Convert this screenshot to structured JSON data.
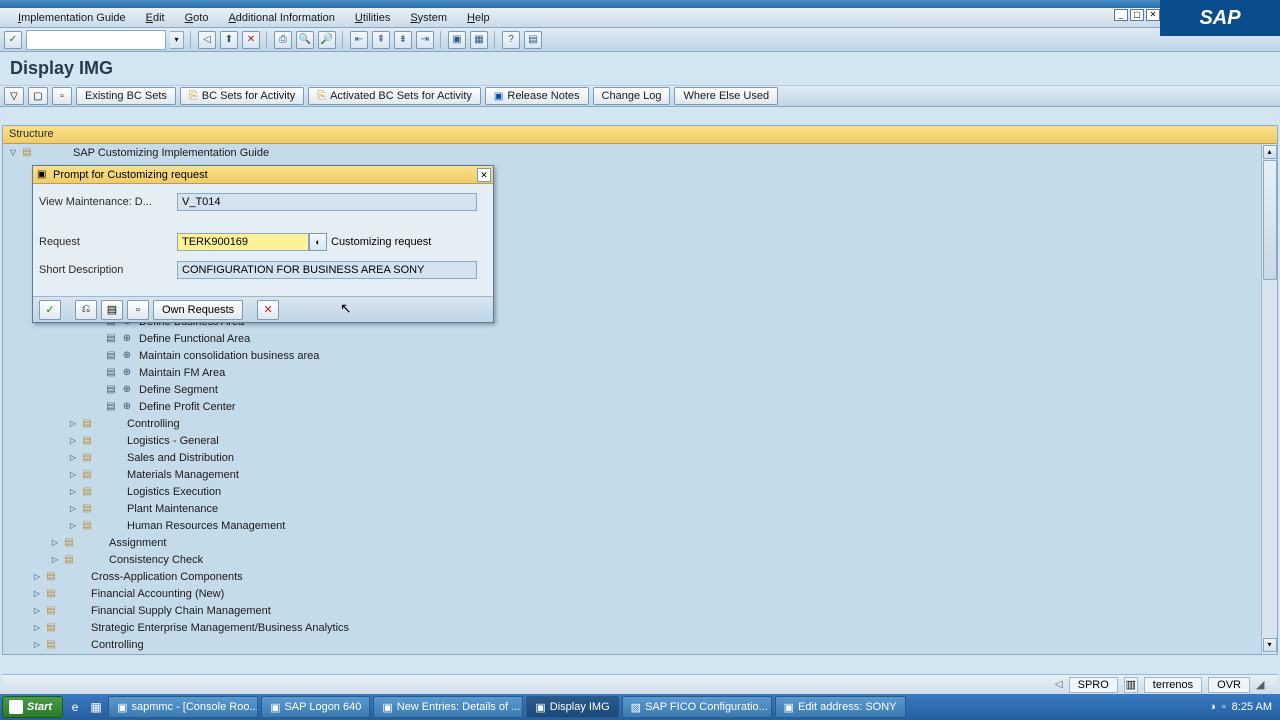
{
  "menubar": {
    "items": [
      "Implementation Guide",
      "Edit",
      "Goto",
      "Additional Information",
      "Utilities",
      "System",
      "Help"
    ]
  },
  "sap_logo": "SAP",
  "page_title": "Display IMG",
  "apptoolbar": {
    "existing_bc": "Existing BC Sets",
    "bc_activity": "BC Sets for Activity",
    "activated_bc": "Activated BC Sets for Activity",
    "release_notes": "Release Notes",
    "change_log": "Change Log",
    "where_else": "Where Else Used"
  },
  "structure_header": "Structure",
  "tree": {
    "root": "SAP Customizing Implementation Guide",
    "items": [
      {
        "indent": 96,
        "exec": true,
        "clock": true,
        "label": "Define Business Area"
      },
      {
        "indent": 96,
        "exec": true,
        "clock": true,
        "label": "Define Functional Area"
      },
      {
        "indent": 96,
        "exec": true,
        "clock": true,
        "label": "Maintain consolidation business area"
      },
      {
        "indent": 96,
        "exec": true,
        "clock": true,
        "label": "Maintain FM Area"
      },
      {
        "indent": 96,
        "exec": true,
        "clock": true,
        "label": "Define Segment"
      },
      {
        "indent": 96,
        "exec": true,
        "clock": true,
        "label": "Define Profit Center"
      },
      {
        "indent": 60,
        "expand": "▷",
        "doc": true,
        "label": "Controlling"
      },
      {
        "indent": 60,
        "expand": "▷",
        "doc": true,
        "label": "Logistics - General"
      },
      {
        "indent": 60,
        "expand": "▷",
        "doc": true,
        "label": "Sales and Distribution"
      },
      {
        "indent": 60,
        "expand": "▷",
        "doc": true,
        "label": "Materials Management"
      },
      {
        "indent": 60,
        "expand": "▷",
        "doc": true,
        "label": "Logistics Execution"
      },
      {
        "indent": 60,
        "expand": "▷",
        "doc": true,
        "label": "Plant Maintenance"
      },
      {
        "indent": 60,
        "expand": "▷",
        "doc": true,
        "label": "Human Resources Management"
      },
      {
        "indent": 42,
        "expand": "▷",
        "doc": true,
        "label": "Assignment"
      },
      {
        "indent": 42,
        "expand": "▷",
        "doc": true,
        "label": "Consistency Check"
      },
      {
        "indent": 24,
        "expand": "▷",
        "doc": true,
        "label": "Cross-Application Components"
      },
      {
        "indent": 24,
        "expand": "▷",
        "doc": true,
        "label": "Financial Accounting (New)"
      },
      {
        "indent": 24,
        "expand": "▷",
        "doc": true,
        "label": "Financial Supply Chain Management"
      },
      {
        "indent": 24,
        "expand": "▷",
        "doc": true,
        "label": "Strategic Enterprise Management/Business Analytics"
      },
      {
        "indent": 24,
        "expand": "▷",
        "doc": true,
        "label": "Controlling"
      }
    ]
  },
  "dialog": {
    "title": "Prompt for Customizing request",
    "view_label": "View Maintenance: D...",
    "view_value": "V_T014",
    "request_label": "Request",
    "request_value": "TERK900169",
    "request_type": "Customizing request",
    "desc_label": "Short Description",
    "desc_value": "CONFIGURATION FOR BUSINESS AREA SONY",
    "own_requests": "Own Requests"
  },
  "statusbar": {
    "tcode": "SPRO",
    "server": "terrenos",
    "mode": "OVR"
  },
  "taskbar": {
    "start": "Start",
    "items": [
      "sapmmc - [Console Roo...",
      "SAP Logon 640",
      "New Entries: Details of ...",
      "Display IMG",
      "SAP FICO Configuratio...",
      "Edit address:  SONY"
    ],
    "time": "8:25 AM"
  }
}
